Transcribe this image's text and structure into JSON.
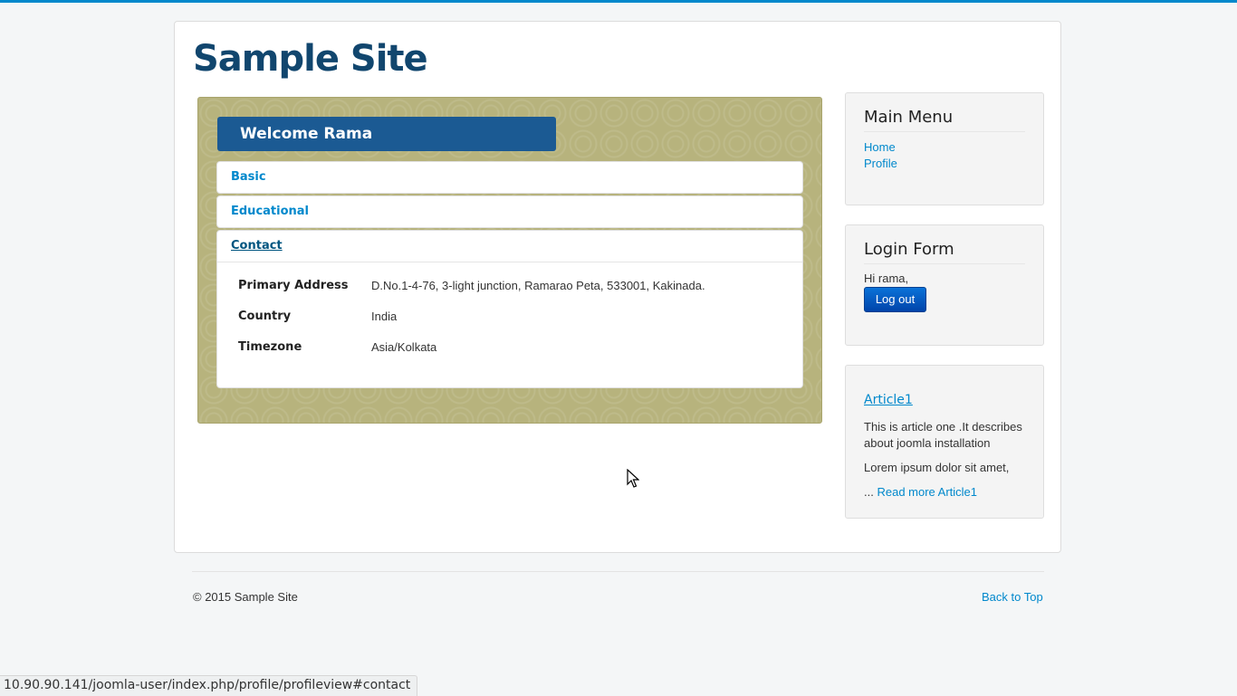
{
  "site": {
    "title": "Sample Site"
  },
  "profile": {
    "welcome": "Welcome Rama",
    "sections": [
      "Basic",
      "Educational",
      "Contact"
    ],
    "contact_rows": [
      {
        "label": "Primary Address",
        "value": "D.No.1-4-76, 3-light junction, Ramarao Peta, 533001, Kakinada."
      },
      {
        "label": "Country",
        "value": "India"
      },
      {
        "label": "Timezone",
        "value": "Asia/Kolkata"
      }
    ]
  },
  "main_menu": {
    "title": "Main Menu",
    "items": [
      "Home",
      "Profile"
    ]
  },
  "login_form": {
    "title": "Login Form",
    "greeting": "Hi rama,",
    "logout_label": "Log out"
  },
  "article": {
    "title": "Article1",
    "text1": "This is article one .It describes about joomla installation",
    "text2": "Lorem ipsum dolor sit amet,",
    "ellipsis": "...",
    "read_more": "Read more Article1"
  },
  "footer": {
    "copyright": "© 2015 Sample Site",
    "back_to_top": "Back to Top"
  },
  "status_bar": {
    "url": "10.90.90.141/joomla-user/index.php/profile/profileview#contact"
  },
  "colors": {
    "accent": "#0088cc",
    "header_blue": "#1b5a93",
    "panel_olive": "#b7b37d"
  }
}
